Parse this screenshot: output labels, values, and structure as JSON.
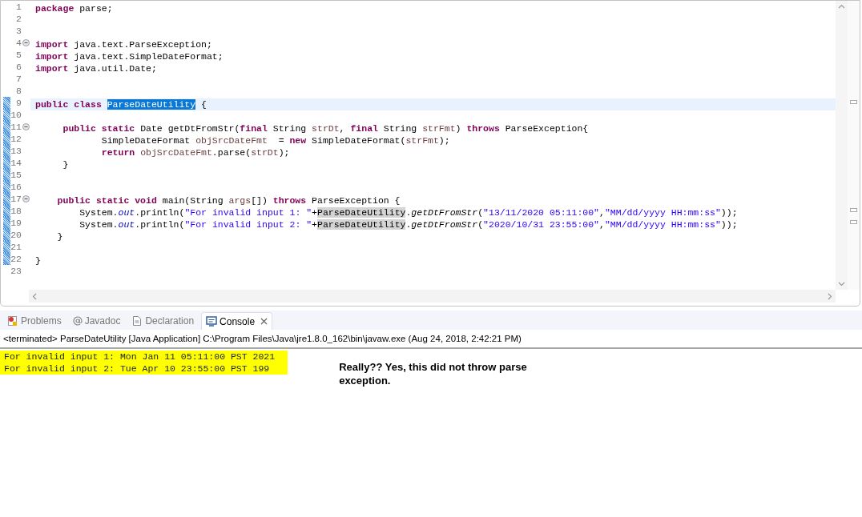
{
  "editor": {
    "lines": [
      {
        "number": "1",
        "fold_marker": false,
        "changed": false,
        "current": false,
        "tokens": [
          {
            "text": "package",
            "kind": "keyword"
          },
          {
            "text": " parse;",
            "kind": "plain"
          }
        ]
      },
      {
        "number": "2",
        "fold_marker": false,
        "changed": false,
        "current": false
      },
      {
        "number": "3",
        "fold_marker": false,
        "changed": false,
        "current": false
      },
      {
        "number": "4",
        "fold_marker": true,
        "changed": false,
        "current": false,
        "tokens": [
          {
            "text": "import",
            "kind": "keyword"
          },
          {
            "text": " java.text.ParseException;",
            "kind": "plain"
          }
        ]
      },
      {
        "number": "5",
        "fold_marker": false,
        "changed": false,
        "current": false,
        "tokens": [
          {
            "text": "import",
            "kind": "keyword"
          },
          {
            "text": " java.text.SimpleDateFormat;",
            "kind": "plain"
          }
        ]
      },
      {
        "number": "6",
        "fold_marker": false,
        "changed": false,
        "current": false,
        "tokens": [
          {
            "text": "import",
            "kind": "keyword"
          },
          {
            "text": " java.util.Date;",
            "kind": "plain"
          }
        ]
      },
      {
        "number": "7",
        "fold_marker": false,
        "changed": false,
        "current": false
      },
      {
        "number": "8",
        "fold_marker": false,
        "changed": false,
        "current": false
      },
      {
        "number": "9",
        "fold_marker": false,
        "changed": true,
        "current": true,
        "tokens": [
          {
            "text": "public class ",
            "kind": "keyword"
          },
          {
            "text": "ParseDateUtility",
            "kind": "selected"
          },
          {
            "text": " {",
            "kind": "plain"
          }
        ]
      },
      {
        "number": "10",
        "fold_marker": false,
        "changed": true,
        "current": false
      },
      {
        "number": "11",
        "fold_marker": true,
        "changed": true,
        "current": false,
        "tokens": [
          {
            "text": "     public static",
            "kind": "keyword"
          },
          {
            "text": " Date getDtFromStr(",
            "kind": "plain"
          },
          {
            "text": "final",
            "kind": "keyword"
          },
          {
            "text": " String ",
            "kind": "plain"
          },
          {
            "text": "strDt",
            "kind": "variable"
          },
          {
            "text": ", ",
            "kind": "plain"
          },
          {
            "text": "final",
            "kind": "keyword"
          },
          {
            "text": " String ",
            "kind": "plain"
          },
          {
            "text": "strFmt",
            "kind": "variable"
          },
          {
            "text": ") ",
            "kind": "plain"
          },
          {
            "text": "throws",
            "kind": "keyword"
          },
          {
            "text": " ParseException{",
            "kind": "plain"
          }
        ]
      },
      {
        "number": "12",
        "fold_marker": false,
        "changed": true,
        "current": false,
        "tokens": [
          {
            "text": "            SimpleDateFormat ",
            "kind": "plain"
          },
          {
            "text": "objSrcDateFmt",
            "kind": "variable"
          },
          {
            "text": "  = ",
            "kind": "plain"
          },
          {
            "text": "new",
            "kind": "keyword"
          },
          {
            "text": " SimpleDateFormat(",
            "kind": "plain"
          },
          {
            "text": "strFmt",
            "kind": "variable"
          },
          {
            "text": ");",
            "kind": "plain"
          }
        ]
      },
      {
        "number": "13",
        "fold_marker": false,
        "changed": true,
        "current": false,
        "tokens": [
          {
            "text": "            return ",
            "kind": "keyword"
          },
          {
            "text": "objSrcDateFmt",
            "kind": "variable"
          },
          {
            "text": ".parse(",
            "kind": "plain"
          },
          {
            "text": "strDt",
            "kind": "variable"
          },
          {
            "text": ");",
            "kind": "plain"
          }
        ]
      },
      {
        "number": "14",
        "fold_marker": false,
        "changed": true,
        "current": false,
        "tokens": [
          {
            "text": "     }",
            "kind": "plain"
          }
        ]
      },
      {
        "number": "15",
        "fold_marker": false,
        "changed": true,
        "current": false
      },
      {
        "number": "16",
        "fold_marker": false,
        "changed": true,
        "current": false
      },
      {
        "number": "17",
        "fold_marker": true,
        "changed": true,
        "current": false,
        "tokens": [
          {
            "text": "    public static void",
            "kind": "keyword"
          },
          {
            "text": " main(String ",
            "kind": "plain"
          },
          {
            "text": "args",
            "kind": "variable"
          },
          {
            "text": "[]) ",
            "kind": "plain"
          },
          {
            "text": "throws",
            "kind": "keyword"
          },
          {
            "text": " ParseException {",
            "kind": "plain"
          }
        ]
      },
      {
        "number": "18",
        "fold_marker": false,
        "changed": true,
        "current": false,
        "tokens": [
          {
            "text": "        System.",
            "kind": "plain"
          },
          {
            "text": "out",
            "kind": "field"
          },
          {
            "text": ".println(",
            "kind": "plain"
          },
          {
            "text": "\"For invalid input 1: \"",
            "kind": "string"
          },
          {
            "text": "+",
            "kind": "plain"
          },
          {
            "text": "ParseDateUtility",
            "kind": "occurrence"
          },
          {
            "text": ".",
            "kind": "plain"
          },
          {
            "text": "getDtFromStr",
            "kind": "static_call"
          },
          {
            "text": "(",
            "kind": "plain"
          },
          {
            "text": "\"13/11/2020 05:11:00\"",
            "kind": "string"
          },
          {
            "text": ",",
            "kind": "plain"
          },
          {
            "text": "\"MM/dd/yyyy HH:mm:ss\"",
            "kind": "string"
          },
          {
            "text": "));",
            "kind": "plain"
          }
        ]
      },
      {
        "number": "19",
        "fold_marker": false,
        "changed": true,
        "current": false,
        "tokens": [
          {
            "text": "        System.",
            "kind": "plain"
          },
          {
            "text": "out",
            "kind": "field"
          },
          {
            "text": ".println(",
            "kind": "plain"
          },
          {
            "text": "\"For invalid input 2: \"",
            "kind": "string"
          },
          {
            "text": "+",
            "kind": "plain"
          },
          {
            "text": "ParseDateUtility",
            "kind": "occurrence"
          },
          {
            "text": ".",
            "kind": "plain"
          },
          {
            "text": "getDtFromStr",
            "kind": "static_call"
          },
          {
            "text": "(",
            "kind": "plain"
          },
          {
            "text": "\"2020/10/31 23:55:00\"",
            "kind": "string"
          },
          {
            "text": ",",
            "kind": "plain"
          },
          {
            "text": "\"MM/dd/yyyy HH:mm:ss\"",
            "kind": "string"
          },
          {
            "text": "));",
            "kind": "plain"
          }
        ]
      },
      {
        "number": "20",
        "fold_marker": false,
        "changed": true,
        "current": false,
        "tokens": [
          {
            "text": "    }",
            "kind": "plain"
          }
        ]
      },
      {
        "number": "21",
        "fold_marker": false,
        "changed": true,
        "current": false
      },
      {
        "number": "22",
        "fold_marker": false,
        "changed": true,
        "current": false,
        "tokens": [
          {
            "text": "}",
            "kind": "plain"
          }
        ]
      },
      {
        "number": "23",
        "fold_marker": false,
        "changed": false,
        "current": false
      }
    ]
  },
  "bottom_panel": {
    "tabs": [
      {
        "label": "Problems",
        "kind": "problems",
        "selected": false
      },
      {
        "label": "Javadoc",
        "kind": "javadoc",
        "selected": false
      },
      {
        "label": "Declaration",
        "kind": "declaration",
        "selected": false
      },
      {
        "label": "Console",
        "kind": "console",
        "selected": true
      }
    ],
    "console_header": "<terminated> ParseDateUtility [Java Application] C:\\Program Files\\Java\\jre1.8.0_162\\bin\\javaw.exe (Aug 24, 2018, 2:42:21 PM)",
    "output": [
      {
        "text": "For invalid input 1: Mon Jan 11 05:11:00 PST 2021",
        "highlighted": true
      },
      {
        "text": "For invalid input 2: Tue Apr 10 23:55:00 PST 199",
        "highlighted": true
      }
    ],
    "annotation": "Really??  Yes, this did not throw parse exception."
  }
}
